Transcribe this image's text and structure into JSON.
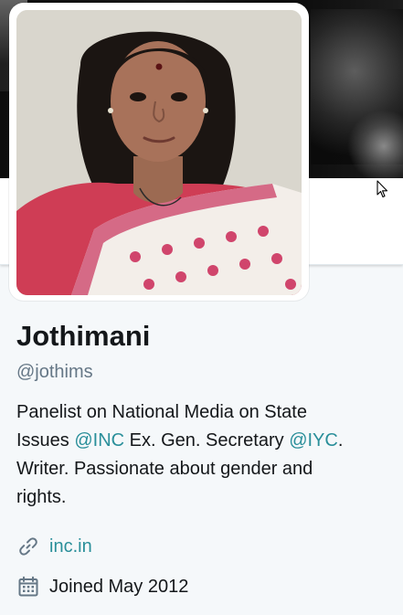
{
  "profile": {
    "name": "Jothimani",
    "handle": "@jothims",
    "bio": {
      "line1": "Panelist on National Media on State",
      "line2_pre": "Issues ",
      "mention_inc": "@INC",
      "line2_mid": " Ex. Gen. Secretary ",
      "mention_iyc": "@IYC",
      "line2_post": ".",
      "line3": "Writer. Passionate about gender and",
      "line4": "rights."
    },
    "url_text": "inc.in",
    "joined_text": "Joined May 2012"
  },
  "icons": {
    "link": "link-icon",
    "calendar": "calendar-icon",
    "cursor": "mouse-cursor-icon"
  },
  "colors": {
    "link": "#2a8f9a",
    "text": "#14171a",
    "muted": "#657786",
    "background": "#f5f8fa"
  }
}
